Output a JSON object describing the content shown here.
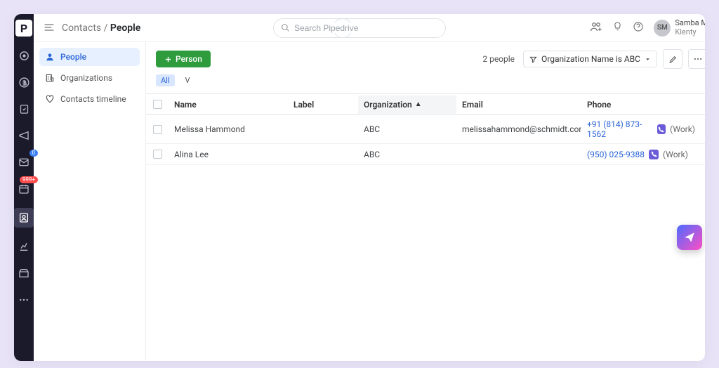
{
  "breadcrumb": {
    "root": "Contacts",
    "sep": "/",
    "leaf": "People"
  },
  "search": {
    "placeholder": "Search Pipedrive"
  },
  "user": {
    "initials": "SM",
    "name": "Samba M",
    "org": "Klenty"
  },
  "leftrail": {
    "badge_mail": "0",
    "badge_cal": "999+"
  },
  "subnav": {
    "people": "People",
    "orgs": "Organizations",
    "timeline": "Contacts timeline"
  },
  "toolbar": {
    "add_label": "Person",
    "count": "2 people",
    "filter_label": "Organization Name is ABC"
  },
  "chips": {
    "all": "All",
    "v": "V"
  },
  "columns": {
    "name": "Name",
    "label": "Label",
    "org": "Organization",
    "email": "Email",
    "phone": "Phone"
  },
  "rows": [
    {
      "name": "Melissa Hammond",
      "org": "ABC",
      "email": "melissahammond@schmidt.com",
      "phone": "+91 (814) 873-1562",
      "phone_type": "(Work)"
    },
    {
      "name": "Alina Lee",
      "org": "ABC",
      "email": "",
      "phone": "(950) 025-9388",
      "phone_type": "(Work)"
    }
  ]
}
